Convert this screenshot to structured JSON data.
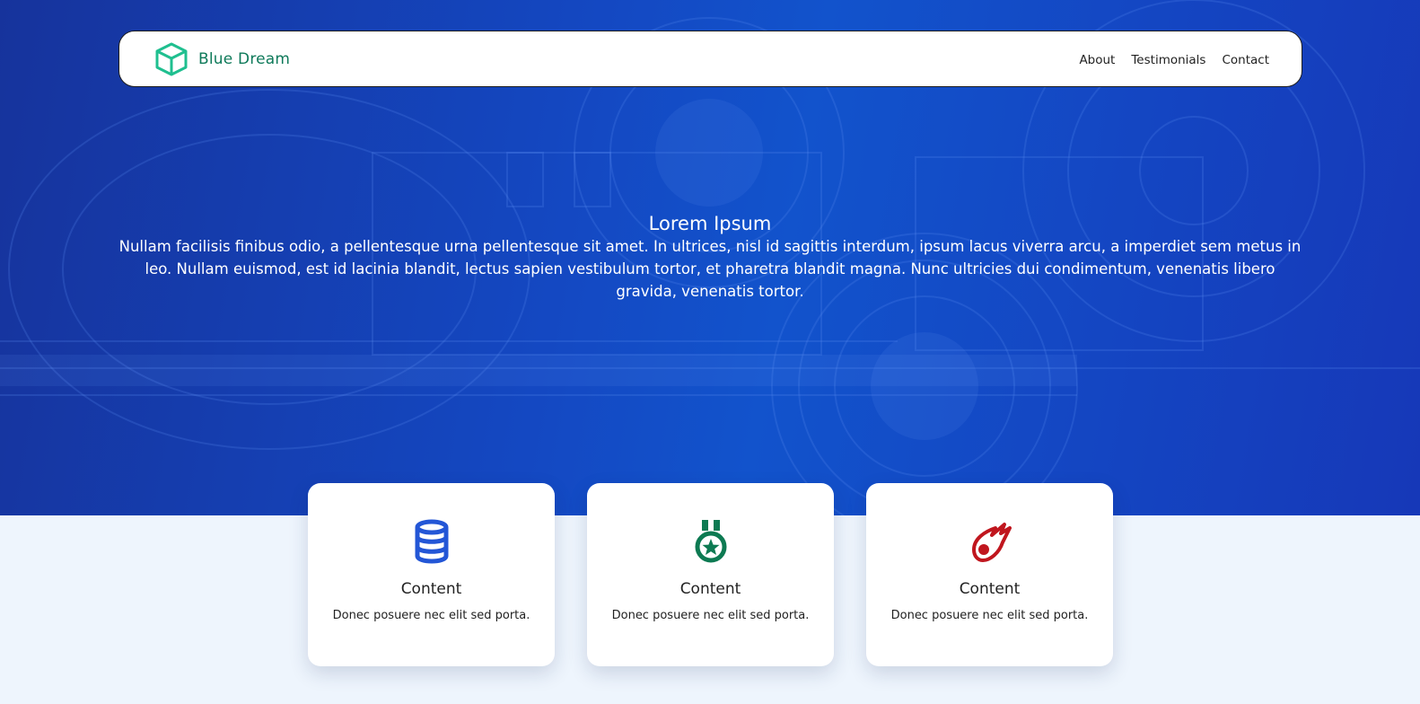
{
  "brand": {
    "name": "Blue Dream",
    "icon": "cube-icon"
  },
  "nav": {
    "items": [
      "About",
      "Testimonials",
      "Contact"
    ]
  },
  "hero": {
    "title": "Lorem Ipsum",
    "description": "Nullam facilisis finibus odio, a pellentesque urna pellentesque sit amet. In ultrices, nisl id sagittis interdum, ipsum lacus viverra arcu, a imperdiet sem metus in leo. Nullam euismod, est id lacinia blandit, lectus sapien vestibulum tortor, et pharetra blandit magna. Nunc ultricies dui condimentum, venenatis libero gravida, venenatis tortor."
  },
  "cards": [
    {
      "icon": "database-icon",
      "color": "#2356d6",
      "title": "Content",
      "text": "Donec posuere nec elit sed porta."
    },
    {
      "icon": "medal-icon",
      "color": "#0d7a52",
      "title": "Content",
      "text": "Donec posuere nec elit sed porta."
    },
    {
      "icon": "meteor-icon",
      "color": "#c0161e",
      "title": "Content",
      "text": "Donec posuere nec elit sed porta."
    }
  ],
  "colors": {
    "hero_background": "#1448c2",
    "brand_green": "#0f7a5a",
    "logo_green": "#1fbf8f",
    "page_background": "#eef5fd"
  }
}
